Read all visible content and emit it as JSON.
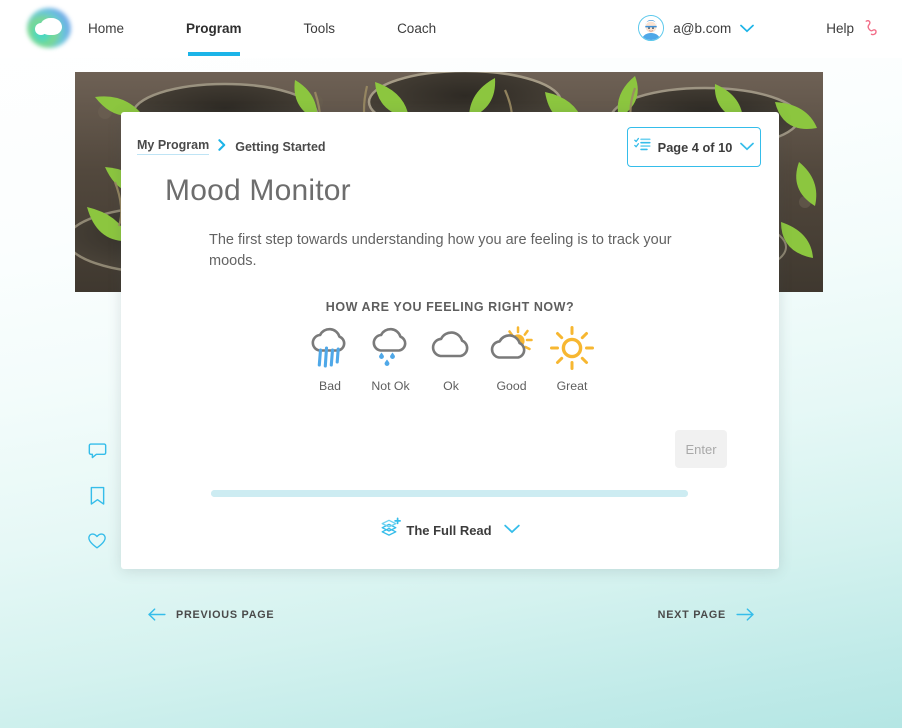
{
  "header": {
    "logo_name": "brand-logo",
    "nav": [
      {
        "label": "Home",
        "active": false
      },
      {
        "label": "Program",
        "active": true
      },
      {
        "label": "Tools",
        "active": false
      },
      {
        "label": "Coach",
        "active": false
      }
    ],
    "account": {
      "email": "a@b.com",
      "avatar_icon": "user-avatar-icon",
      "chevron_icon": "chevron-down-icon"
    },
    "help": {
      "label": "Help",
      "icon": "phone-icon"
    }
  },
  "card": {
    "breadcrumb": {
      "root": "My Program",
      "separator_icon": "chevron-right-icon",
      "current": "Getting Started"
    },
    "page_badge": {
      "icon": "checklist-icon",
      "label": "Page 4 of 10",
      "chevron_icon": "chevron-down-icon",
      "current_page": 4,
      "total_pages": 10
    },
    "title": "Mood Monitor",
    "body": "The first step towards understanding how you are feeling is to track your moods.",
    "mood_prompt": "HOW ARE YOU FEELING RIGHT NOW?",
    "moods": [
      {
        "label": "Bad",
        "icon": "cloud-heavy-rain-icon"
      },
      {
        "label": "Not Ok",
        "icon": "cloud-drizzle-icon"
      },
      {
        "label": "Ok",
        "icon": "cloud-icon"
      },
      {
        "label": "Good",
        "icon": "sun-behind-cloud-icon"
      },
      {
        "label": "Great",
        "icon": "sun-icon"
      }
    ],
    "enter_button": "Enter",
    "progress_percent": 100,
    "full_read": {
      "icon": "layers-plus-icon",
      "label": "The Full Read",
      "chevron_icon": "chevron-down-icon"
    }
  },
  "side_rail": [
    {
      "icon": "comment-icon",
      "name": "comment"
    },
    {
      "icon": "bookmark-icon",
      "name": "bookmark"
    },
    {
      "icon": "heart-icon",
      "name": "favorite"
    }
  ],
  "page_nav": {
    "previous": "PREVIOUS PAGE",
    "next": "NEXT PAGE",
    "prev_icon": "arrow-left-icon",
    "next_icon": "arrow-right-icon"
  },
  "colors": {
    "accent_cyan": "#1CB4E8",
    "rail_cyan": "#35BDEA",
    "sun_yellow": "#F7B731",
    "rain_blue": "#4FA8E8",
    "cloud_gray": "#7a7a7a",
    "help_pink": "#F26D88"
  }
}
